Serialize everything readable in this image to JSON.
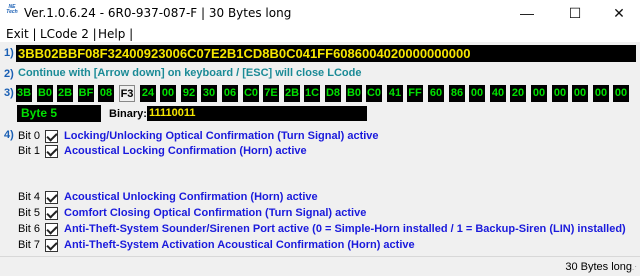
{
  "titlebar": {
    "logo_text": "NE Tech",
    "title": "Ver.1.0.6.24 -     6R0-937-087-F | 30 Bytes long",
    "minimize": "—",
    "maximize": "☐",
    "close": "✕"
  },
  "menu": {
    "exit": "Exit |",
    "lcode2": "LCode 2 |",
    "help": "Help |"
  },
  "steps": {
    "s1": "1)",
    "s2": "2)",
    "s3": "3)",
    "s4": "4)"
  },
  "hex_string": "3BB02BBF08F32400923006C07E2B1CD8B0C041FF6086004020000000000",
  "instruction": "Continue with [Arrow down] on keyboard / [ESC] will close LCode",
  "bytes": [
    "3B",
    "B0",
    "2B",
    "BF",
    "08",
    "F3",
    "24",
    "00",
    "92",
    "30",
    "06",
    "C0",
    "7E",
    "2B",
    "1C",
    "D8",
    "B0",
    "C0",
    "41",
    "FF",
    "60",
    "86",
    "00",
    "40",
    "20",
    "00",
    "00",
    "00",
    "00",
    "00"
  ],
  "selected_byte_index": 5,
  "byte_label": "Byte 5",
  "binary_label": "Binary:",
  "binary_value": "11110011",
  "bits": [
    {
      "name": "Bit 0",
      "desc": "Locking/Unlocking Optical Confirmation (Turn Signal) active"
    },
    {
      "name": "Bit 1",
      "desc": "Acoustical Locking Confirmation (Horn) active"
    },
    {
      "name": "Bit 4",
      "desc": "Acoustical Unlocking Confirmation (Horn) active"
    },
    {
      "name": "Bit 5",
      "desc": "Comfort Closing Optical Confirmation (Turn Signal) active"
    },
    {
      "name": "Bit 6",
      "desc": "Anti-Theft-System Sounder/Sirenen Port active (0 = Simple-Horn installed / 1 = Backup-Siren (LIN) installed)"
    },
    {
      "name": "Bit 7",
      "desc": "Anti-Theft-System Activation Acoustical Confirmation (Horn) active"
    }
  ],
  "status": "30 Bytes long",
  "colors": {
    "hex_text": "#f5e600",
    "byte_text": "#00e000",
    "bit_desc": "#1a1adc",
    "step_num": "#1a5fb4",
    "instruction": "#1a8a96"
  }
}
